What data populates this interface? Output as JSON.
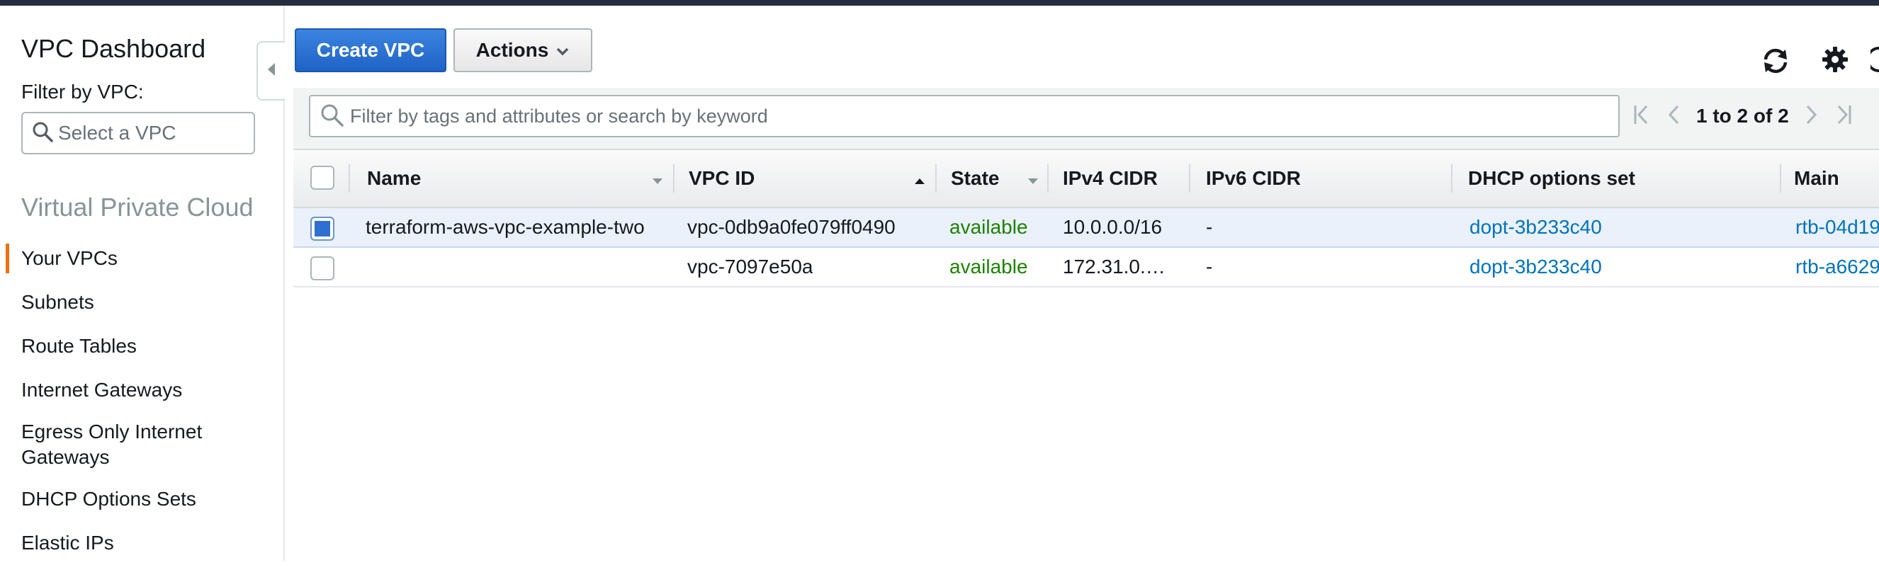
{
  "sidebar": {
    "title": "VPC Dashboard",
    "filter_label": "Filter by VPC:",
    "filter_placeholder": "Select a VPC",
    "section": "Virtual Private Cloud",
    "items": [
      {
        "label": "Your VPCs"
      },
      {
        "label": "Subnets"
      },
      {
        "label": "Route Tables"
      },
      {
        "label": "Internet Gateways"
      },
      {
        "label": "Egress Only Internet Gateways"
      },
      {
        "label": "DHCP Options Sets"
      },
      {
        "label": "Elastic IPs"
      }
    ]
  },
  "toolbar": {
    "create_label": "Create VPC",
    "actions_label": "Actions"
  },
  "filter": {
    "placeholder": "Filter by tags and attributes or search by keyword"
  },
  "pagination": {
    "text": "1 to 2 of 2"
  },
  "table": {
    "columns": [
      "Name",
      "VPC ID",
      "State",
      "IPv4 CIDR",
      "IPv6 CIDR",
      "DHCP options set",
      "Main Rou"
    ],
    "rows": [
      {
        "selected": true,
        "name": "terraform-aws-vpc-example-two",
        "vpc_id": "vpc-0db9a0fe079ff0490",
        "state": "available",
        "ipv4": "10.0.0.0/16",
        "ipv6": "-",
        "dhcp": "dopt-3b233c40",
        "route": "rtb-04d19"
      },
      {
        "selected": false,
        "name": "",
        "vpc_id": "vpc-7097e50a",
        "state": "available",
        "ipv4": "172.31.0.…",
        "ipv6": "-",
        "dhcp": "dopt-3b233c40",
        "route": "rtb-a6629"
      }
    ]
  },
  "colors": {
    "accent": "#ec7211",
    "primary_button": "#1f63c6",
    "link": "#0073bb",
    "available": "#1d8102"
  }
}
